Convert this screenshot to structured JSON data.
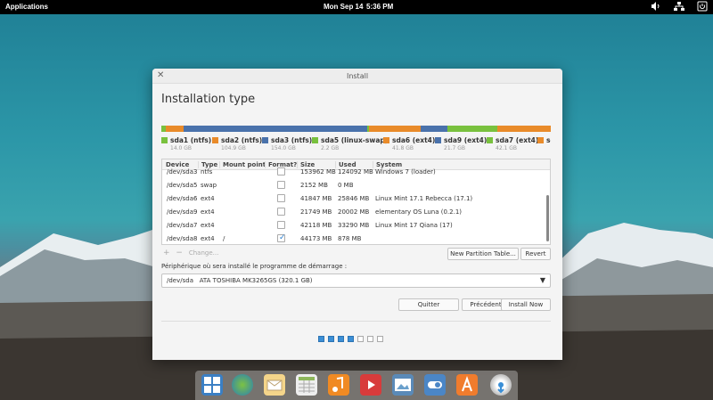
{
  "top_panel": {
    "applications": "Applications",
    "date": "Mon Sep 14",
    "time": "5:36 PM",
    "tray_icons": [
      "volume-icon",
      "network-icon",
      "power-icon"
    ]
  },
  "window": {
    "title": "Install",
    "heading": "Installation type",
    "partitions": [
      {
        "name": "sda1 (ntfs)",
        "size": "14.0 GB",
        "color": "#79c13e"
      },
      {
        "name": "sda2 (ntfs)",
        "size": "104.9 GB",
        "color": "#e98b2a"
      },
      {
        "name": "sda3 (ntfs)",
        "size": "154.0 GB",
        "color": "#4a72ab"
      },
      {
        "name": "sda5 (linux-swap)",
        "size": "2.2 GB",
        "color": "#79c13e"
      },
      {
        "name": "sda6 (ext4)",
        "size": "41.8 GB",
        "color": "#e98b2a"
      },
      {
        "name": "sda9 (ext4)",
        "size": "21.7 GB",
        "color": "#4a72ab"
      },
      {
        "name": "sda7 (ext4)",
        "size": "42.1 GB",
        "color": "#79c13e"
      },
      {
        "name": "sd",
        "size": "",
        "color": "#e98b2a"
      }
    ],
    "table": {
      "headers": [
        "Device",
        "Type",
        "Mount point",
        "Format?",
        "Size",
        "Used",
        "System"
      ],
      "rows": [
        {
          "device": "/dev/sda3",
          "type": "ntfs",
          "mount": "",
          "format": false,
          "size": "153962 MB",
          "used": "124092 MB",
          "system": "Windows 7 (loader)"
        },
        {
          "device": "/dev/sda5",
          "type": "swap",
          "mount": "",
          "format": false,
          "size": "2152 MB",
          "used": "0 MB",
          "system": ""
        },
        {
          "device": "/dev/sda6",
          "type": "ext4",
          "mount": "",
          "format": false,
          "size": "41847 MB",
          "used": "25846 MB",
          "system": "Linux Mint 17.1 Rebecca (17.1)"
        },
        {
          "device": "/dev/sda9",
          "type": "ext4",
          "mount": "",
          "format": false,
          "size": "21749 MB",
          "used": "20002 MB",
          "system": "elementary OS Luna (0.2.1)"
        },
        {
          "device": "/dev/sda7",
          "type": "ext4",
          "mount": "",
          "format": false,
          "size": "42118 MB",
          "used": "33290 MB",
          "system": "Linux Mint 17 Qiana (17)"
        },
        {
          "device": "/dev/sda8",
          "type": "ext4",
          "mount": "/",
          "format": true,
          "size": "44173 MB",
          "used": "878 MB",
          "system": ""
        }
      ]
    },
    "add_label": "+",
    "remove_label": "−",
    "change_label": "Change...",
    "new_partition_table": "New Partition Table...",
    "revert": "Revert",
    "boot_label": "Périphérique où sera installé le programme de démarrage :",
    "boot_device": "/dev/sda",
    "boot_device_desc": "ATA TOSHIBA MK3265GS (320.1 GB)",
    "quit": "Quitter",
    "back": "Précédent",
    "install_now": "Install Now",
    "steps_total": 7,
    "steps_done": 4
  },
  "dock": {
    "apps": [
      "multitasking-view-icon",
      "web-browser-icon",
      "mail-icon",
      "calendar-icon",
      "music-icon",
      "videos-icon",
      "photos-icon",
      "settings-icon",
      "app-center-icon",
      "install-icon"
    ]
  }
}
